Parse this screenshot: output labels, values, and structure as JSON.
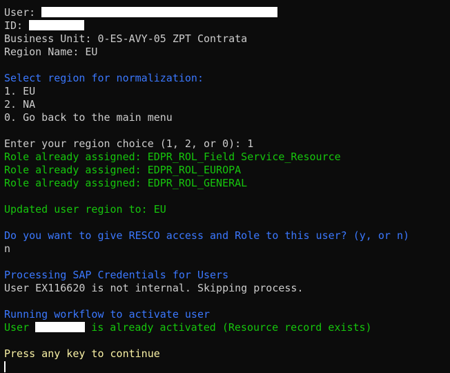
{
  "terminal": {
    "user_label": "User:",
    "id_label": "ID:",
    "business_unit": "Business Unit: 0-ES-AVY-05 ZPT Contrata",
    "region_name": "Region Name: EU",
    "select_prompt": "Select region for normalization:",
    "option_1": "1. EU",
    "option_2": "2. NA",
    "option_0": "0. Go back to the main menu",
    "enter_choice": "Enter your region choice (1, 2, or 0): 1",
    "role_1": "Role already assigned: EDPR_ROL_Field Service_Resource",
    "role_2": "Role already assigned: EDPR_ROL_EUROPA",
    "role_3": "Role already assigned: EDPR_ROL_GENERAL",
    "updated_region": "Updated user region to: EU",
    "resco_prompt": "Do you want to give RESCO access and Role to this user? (y, or n)",
    "resco_answer": "n",
    "sap_processing": "Processing SAP Credentials for Users",
    "sap_skip": "User EX116620 is not internal. Skipping process.",
    "workflow_running": "Running workflow to activate user",
    "activated_prefix": "User",
    "activated_suffix": "is already activated (Resource record exists)",
    "press_any_key": "Press any key to continue"
  },
  "colors": {
    "background": "#0c0c0c",
    "default_text": "#cccccc",
    "blue_text": "#3b78ff",
    "green_text": "#16c60c",
    "yellow_text": "#f9f1a5"
  }
}
